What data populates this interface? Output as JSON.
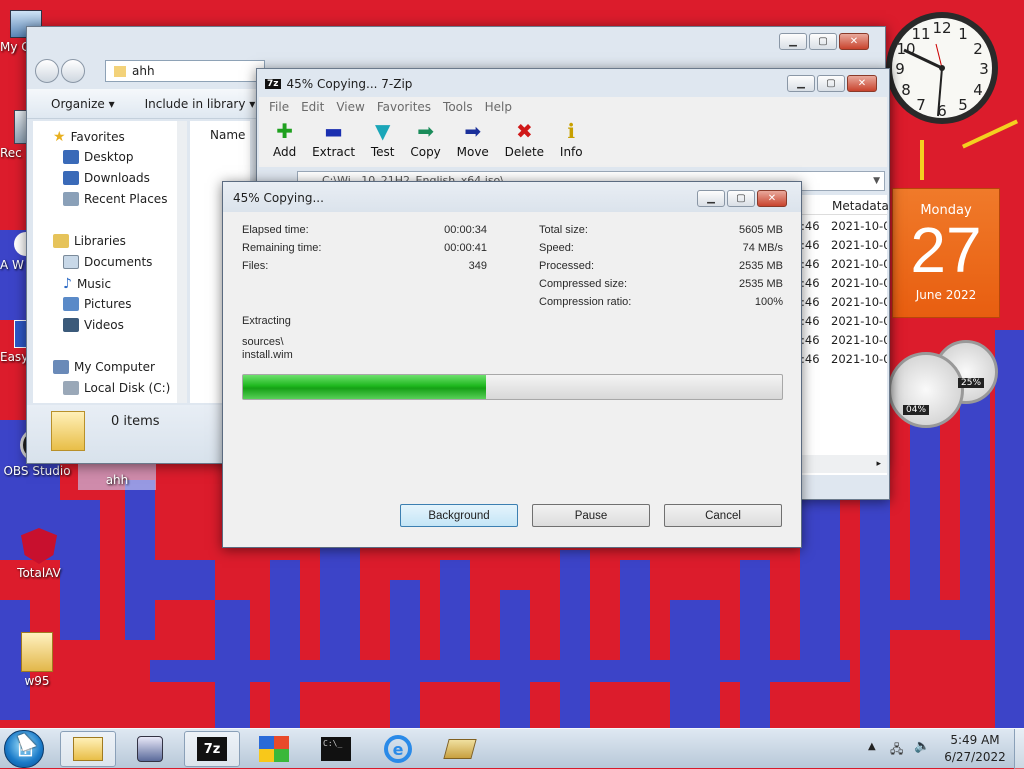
{
  "desktop": {
    "icons": [
      {
        "label": "My C",
        "icon": "computer-icon"
      },
      {
        "label": "Rec",
        "icon": "recycle-bin-icon"
      },
      {
        "label": "A W",
        "icon": "app-icon"
      },
      {
        "label": "Easy",
        "icon": "app-icon"
      },
      {
        "label": "OBS Studio",
        "icon": "obs-icon"
      },
      {
        "label": "ahh",
        "icon": "folder-icon"
      },
      {
        "label": "TotalAV",
        "icon": "shield-icon"
      },
      {
        "label": "w95",
        "icon": "folder-icon"
      }
    ]
  },
  "gadgets": {
    "clock": {
      "numbers": [
        "12",
        "1",
        "2",
        "3",
        "4",
        "5",
        "6",
        "7",
        "8",
        "9",
        "10",
        "11"
      ]
    },
    "calendar": {
      "weekday": "Monday",
      "day": "27",
      "month_year": "June 2022"
    },
    "meter": {
      "cpu": "04%",
      "ram": "25%"
    }
  },
  "explorer": {
    "path": "ahh",
    "toolbar": {
      "organize": "Organize",
      "include": "Include in library"
    },
    "column_name": "Name",
    "nav": {
      "favorites": "Favorites",
      "fav_items": [
        "Desktop",
        "Downloads",
        "Recent Places"
      ],
      "libraries": "Libraries",
      "lib_items": [
        "Documents",
        "Music",
        "Pictures",
        "Videos"
      ],
      "computer": "My Computer",
      "computer_items": [
        "Local Disk (C:)"
      ]
    },
    "status": "0 items"
  },
  "zip": {
    "title": "45% Copying... 7-Zip",
    "menu": [
      "File",
      "Edit",
      "View",
      "Favorites",
      "Tools",
      "Help"
    ],
    "toolbar": [
      {
        "label": "Add",
        "icon": "add-icon",
        "color": "#1fa01f",
        "glyph": "✚"
      },
      {
        "label": "Extract",
        "icon": "extract-icon",
        "color": "#1a2fb0",
        "glyph": "▬"
      },
      {
        "label": "Test",
        "icon": "test-icon",
        "color": "#1aa6b8",
        "glyph": "▼"
      },
      {
        "label": "Copy",
        "icon": "copy-icon",
        "color": "#1a8c5a",
        "glyph": "➡"
      },
      {
        "label": "Move",
        "icon": "move-icon",
        "color": "#1a2f9a",
        "glyph": "➡"
      },
      {
        "label": "Delete",
        "icon": "delete-icon",
        "color": "#d01818",
        "glyph": "✖"
      },
      {
        "label": "Info",
        "icon": "info-icon",
        "color": "#c8a000",
        "glyph": "ℹ"
      }
    ],
    "address": "C:\\Wi...10_21H2_English_x64.iso\\",
    "col_metadata": "Metadata",
    "rows": [
      {
        "time": ":46",
        "meta": "2021-10-0"
      },
      {
        "time": ":46",
        "meta": "2021-10-0"
      },
      {
        "time": ":46",
        "meta": "2021-10-0"
      },
      {
        "time": ":46",
        "meta": "2021-10-0"
      },
      {
        "time": ":46",
        "meta": "2021-10-0"
      },
      {
        "time": ":46",
        "meta": "2021-10-0"
      },
      {
        "time": ":46",
        "meta": "2021-10-0"
      },
      {
        "time": ":46",
        "meta": "2021-10-0"
      }
    ]
  },
  "progress": {
    "title": "45% Copying...",
    "left": [
      {
        "label": "Elapsed time:",
        "value": "00:00:34"
      },
      {
        "label": "Remaining time:",
        "value": "00:00:41"
      },
      {
        "label": "Files:",
        "value": "349"
      }
    ],
    "right": [
      {
        "label": "Total size:",
        "value": "5605 MB"
      },
      {
        "label": "Speed:",
        "value": "74 MB/s"
      },
      {
        "label": "Processed:",
        "value": "2535 MB"
      },
      {
        "label": "Compressed size:",
        "value": "2535 MB"
      },
      {
        "label": "Compression ratio:",
        "value": "100%"
      }
    ],
    "action": "Extracting",
    "file_dir": "sources\\",
    "file_name": "install.wim",
    "percent": 45,
    "buttons": {
      "background": "Background",
      "pause": "Pause",
      "cancel": "Cancel"
    }
  },
  "taskbar": {
    "time": "5:49 AM",
    "date": "6/27/2022",
    "apps": [
      "explorer-icon",
      "media-icon",
      "7zip-icon",
      "windows-logo-icon",
      "cmd-icon",
      "ie-icon",
      "app-stack-icon"
    ],
    "z7": "7z",
    "cmd": "C:\\_"
  }
}
